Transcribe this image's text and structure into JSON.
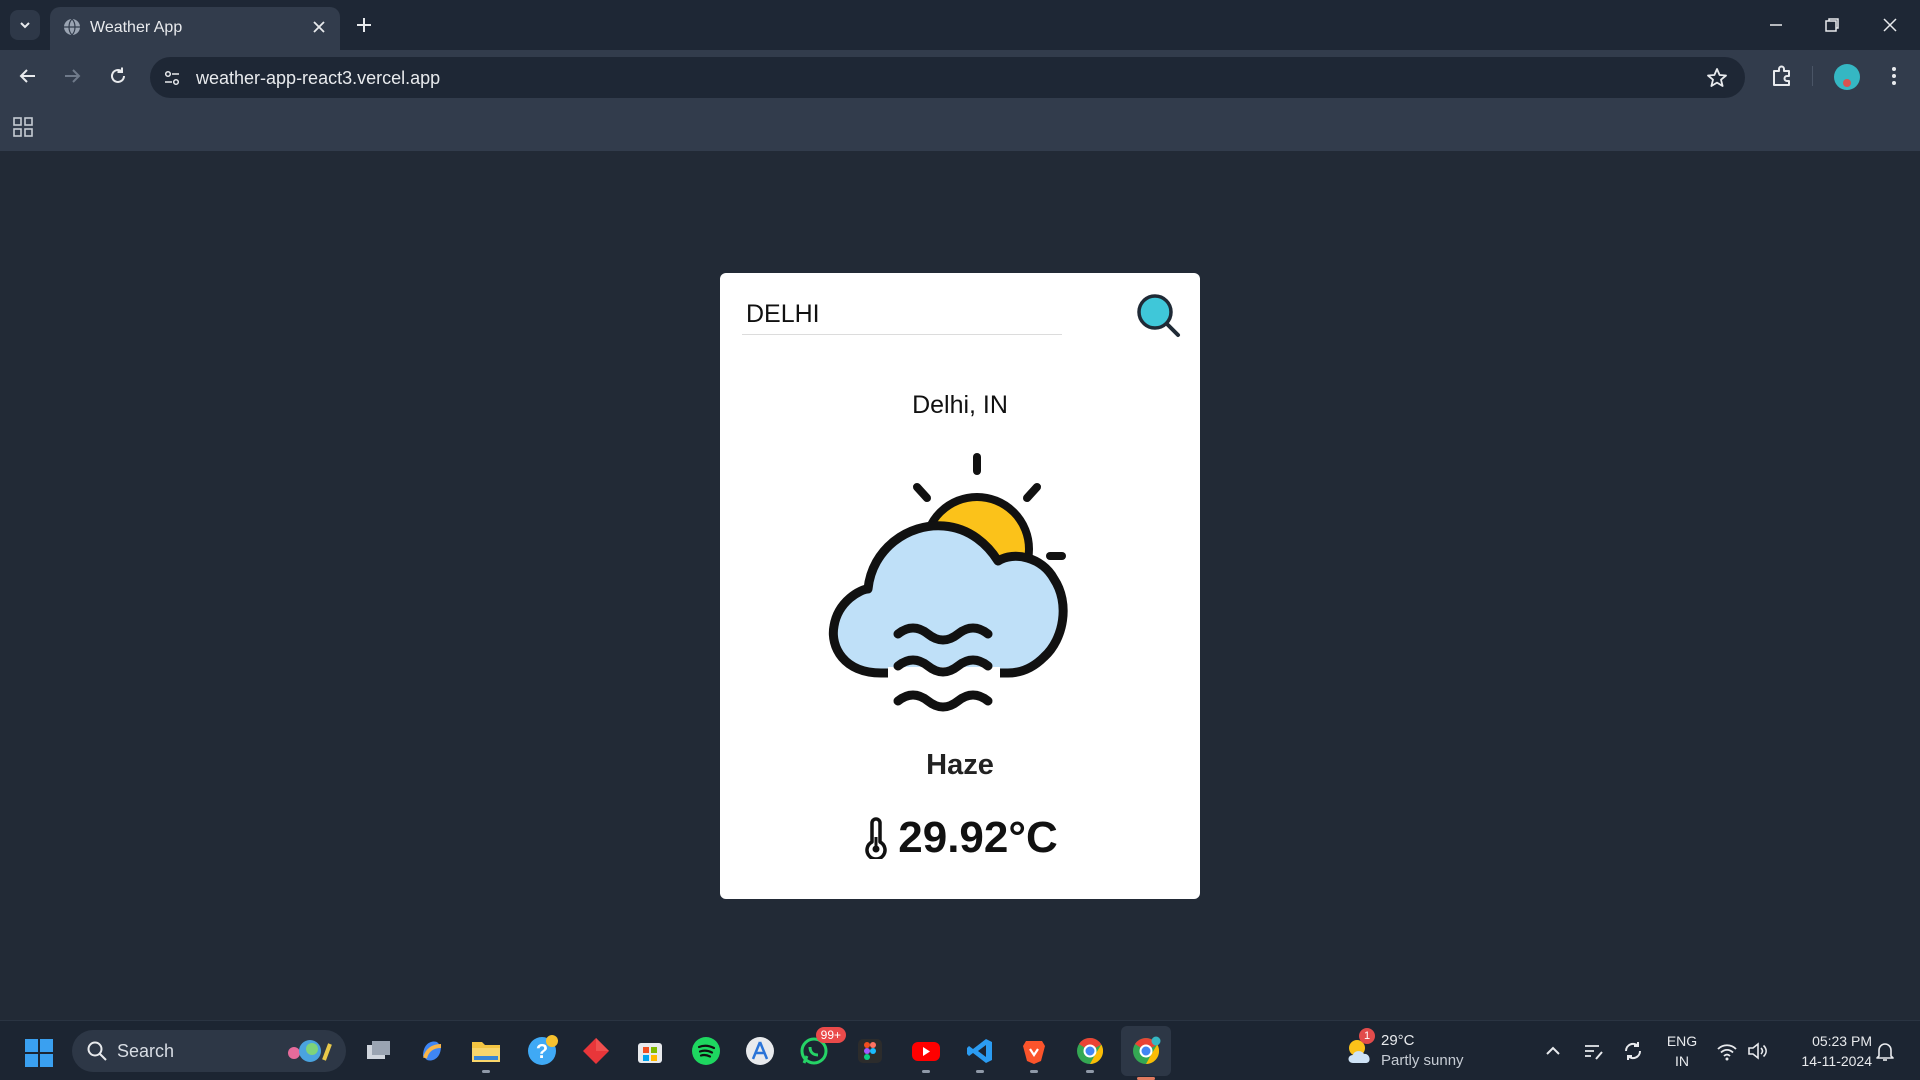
{
  "browser": {
    "tab_title": "Weather App",
    "url": "weather-app-react3.vercel.app"
  },
  "weather_card": {
    "search_value": "DELHI",
    "city": "Delhi, IN",
    "condition": "Haze",
    "temperature": "29.92°C",
    "icon": "haze-cloud-sun-icon",
    "accent_color": "#3fc7d9"
  },
  "taskbar": {
    "search_label": "Search",
    "whatsapp_badge": "99+",
    "weather_badge": "1",
    "weather_temp": "29°C",
    "weather_desc": "Partly sunny",
    "lang_top": "ENG",
    "lang_bottom": "IN",
    "time": "05:23 PM",
    "date": "14-11-2024"
  },
  "colors": {
    "page_background": "#222a36",
    "card_background": "#ffffff",
    "cloud": "#bfe0f8",
    "sun": "#fbc21a"
  }
}
